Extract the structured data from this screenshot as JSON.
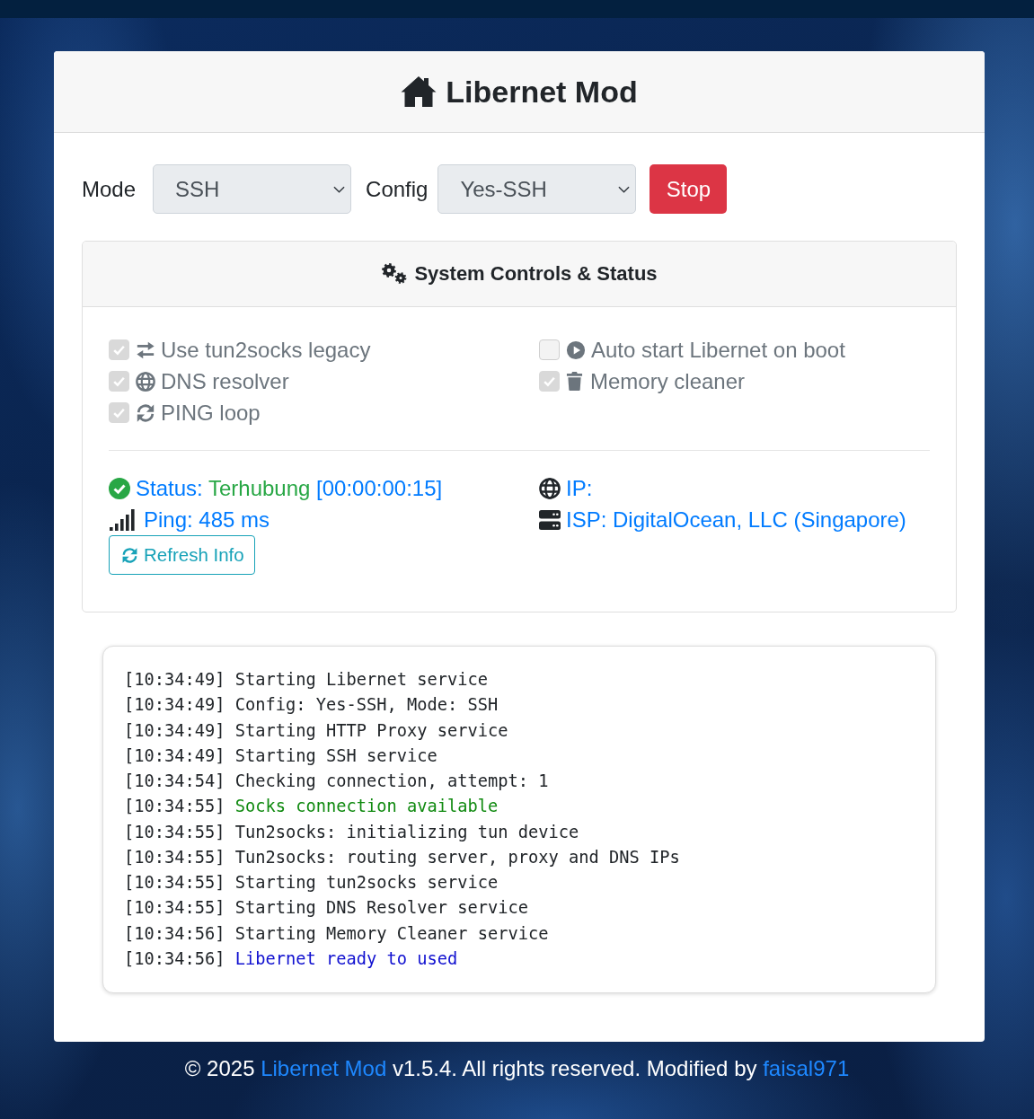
{
  "header": {
    "title": "Libernet Mod"
  },
  "controls": {
    "mode": {
      "label": "Mode",
      "value": "SSH"
    },
    "config": {
      "label": "Config",
      "value": "Yes-SSH"
    },
    "action_button": "Stop"
  },
  "system_panel": {
    "title": "System Controls & Status",
    "option_columns": [
      [
        {
          "label": "Use tun2socks legacy",
          "checked": true,
          "disabled": true
        },
        {
          "label": "DNS resolver",
          "checked": true,
          "disabled": true
        },
        {
          "label": "PING loop",
          "checked": true,
          "disabled": true
        }
      ],
      [
        {
          "label": "Auto start Libernet on boot",
          "checked": false,
          "disabled": true
        },
        {
          "label": "Memory cleaner",
          "checked": true,
          "disabled": true
        }
      ]
    ],
    "status": {
      "label": "Status:",
      "value": "Terhubung",
      "connected": true,
      "uptime": "[00:00:00:15]"
    },
    "ping": "Ping: 485 ms",
    "refresh_button": "Refresh Info",
    "ip": "IP:",
    "isp": "ISP: DigitalOcean, LLC (Singapore)"
  },
  "log": [
    {
      "time": "[10:34:49]",
      "message": "Starting Libernet service",
      "kind": "normal"
    },
    {
      "time": "[10:34:49]",
      "message": "Config: Yes-SSH, Mode: SSH",
      "kind": "normal"
    },
    {
      "time": "[10:34:49]",
      "message": "Starting HTTP Proxy service",
      "kind": "normal"
    },
    {
      "time": "[10:34:49]",
      "message": "Starting SSH service",
      "kind": "normal"
    },
    {
      "time": "[10:34:54]",
      "message": "Checking connection, attempt: 1",
      "kind": "normal"
    },
    {
      "time": "[10:34:55]",
      "message": "Socks connection available",
      "kind": "success"
    },
    {
      "time": "[10:34:55]",
      "message": "Tun2socks: initializing tun device",
      "kind": "normal"
    },
    {
      "time": "[10:34:55]",
      "message": "Tun2socks: routing server, proxy and DNS IPs",
      "kind": "normal"
    },
    {
      "time": "[10:34:55]",
      "message": "Starting tun2socks service",
      "kind": "normal"
    },
    {
      "time": "[10:34:55]",
      "message": "Starting DNS Resolver service",
      "kind": "normal"
    },
    {
      "time": "[10:34:56]",
      "message": "Starting Memory Cleaner service",
      "kind": "normal"
    },
    {
      "time": "[10:34:56]",
      "message": "Libernet ready to used",
      "kind": "info"
    }
  ],
  "footer": {
    "copyright": "© 2025",
    "app_link": "Libernet Mod",
    "text": "v1.5.4. All rights reserved. Modified by",
    "author_link": "faisal971"
  }
}
